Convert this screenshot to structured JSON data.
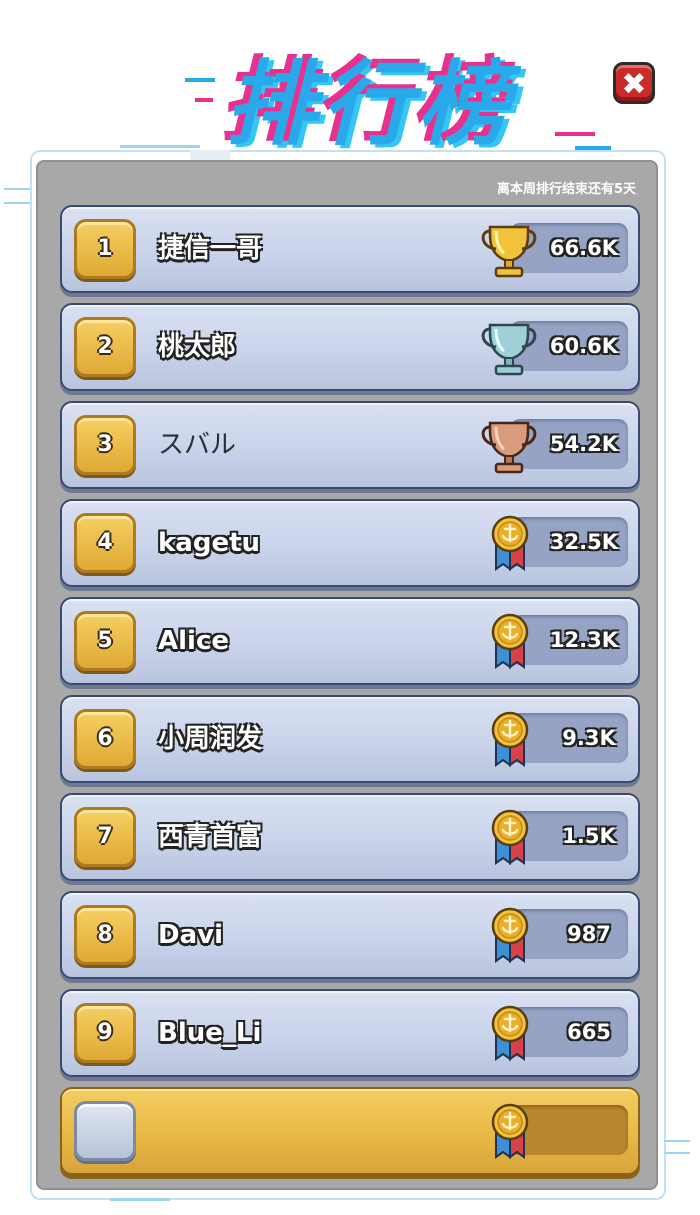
{
  "title": "排行榜",
  "close_label": "✖",
  "countdown_text": "离本周排行结束还有5天",
  "rows": [
    {
      "rank": "1",
      "name": "捷信一哥",
      "score": "66.6K",
      "reward": "gold-trophy-icon"
    },
    {
      "rank": "2",
      "name": "桃太郎",
      "score": "60.6K",
      "reward": "silver-trophy-icon"
    },
    {
      "rank": "3",
      "name": "スバル",
      "score": "54.2K",
      "reward": "bronze-trophy-icon"
    },
    {
      "rank": "4",
      "name": "kagetu",
      "score": "32.5K",
      "reward": "anchor-medal-icon"
    },
    {
      "rank": "5",
      "name": "Alice",
      "score": "12.3K",
      "reward": "anchor-medal-icon"
    },
    {
      "rank": "6",
      "name": "小周润发",
      "score": "9.3K",
      "reward": "anchor-medal-icon"
    },
    {
      "rank": "7",
      "name": "西青首富",
      "score": "1.5K",
      "reward": "anchor-medal-icon"
    },
    {
      "rank": "8",
      "name": "Davi",
      "score": "987",
      "reward": "anchor-medal-icon"
    },
    {
      "rank": "9",
      "name": "Blue_Li",
      "score": "665",
      "reward": "anchor-medal-icon"
    }
  ],
  "my_row": {
    "rank": "",
    "name": "",
    "score": "",
    "reward": "anchor-medal-icon"
  },
  "colors": {
    "title_blue": "#29a9ea",
    "title_pink": "#e8308f",
    "gold_badge": "#e6b23c",
    "row_bg": "#cdd6ec",
    "panel_bg": "#a8a8a8"
  }
}
